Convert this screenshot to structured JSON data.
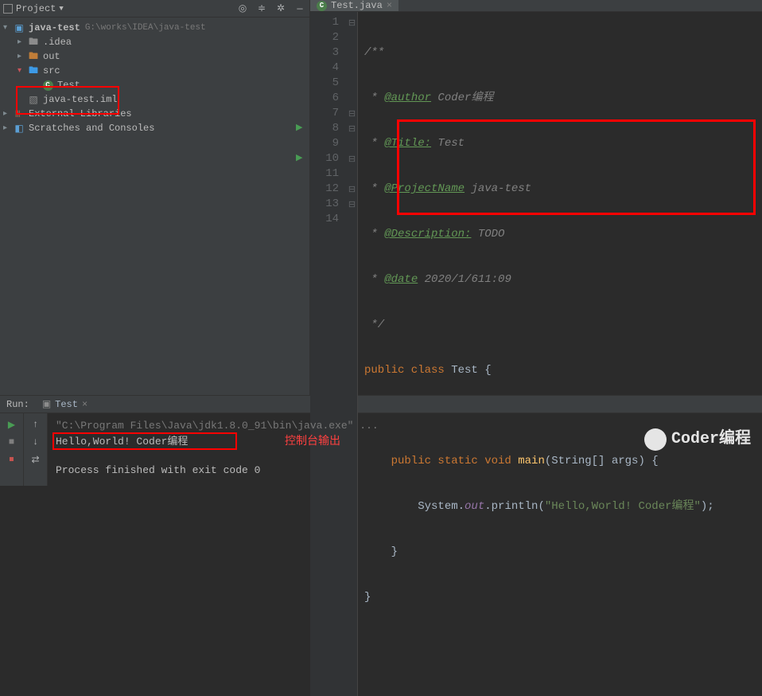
{
  "sidebar": {
    "title": "Project",
    "project": {
      "name": "java-test",
      "path": "G:\\works\\IDEA\\java-test"
    },
    "items": [
      {
        "label": ".idea"
      },
      {
        "label": "out"
      },
      {
        "label": "src"
      },
      {
        "label": "Test"
      },
      {
        "label": "java-test.iml"
      }
    ],
    "external": "External Libraries",
    "scratches": "Scratches and Consoles"
  },
  "editor": {
    "tab_name": "Test.java",
    "lines": {
      "n1": "1",
      "n2": "2",
      "n3": "3",
      "n4": "4",
      "n5": "5",
      "n6": "6",
      "n7": "7",
      "n8": "8",
      "n9": "9",
      "n10": "10",
      "n11": "11",
      "n12": "12",
      "n13": "13",
      "n14": "14"
    },
    "code": {
      "l1": "/**",
      "l2_pre": " * ",
      "l2_tag": "@author",
      "l2_rest": " Coder编程",
      "l3_pre": " * ",
      "l3_tag": "@Title:",
      "l3_rest": " Test",
      "l4_pre": " * ",
      "l4_tag": "@ProjectName",
      "l4_rest": " java-test",
      "l5_pre": " * ",
      "l5_tag": "@Description:",
      "l5_rest": " TODO",
      "l6_pre": " * ",
      "l6_tag": "@date",
      "l6_rest": " 2020/1/611:09",
      "l7": " */",
      "l8_kw1": "public class ",
      "l8_name": "Test ",
      "l8_brace": "{",
      "l10_kw": "    public static void ",
      "l10_name": "main",
      "l10_params": "(String[] args) {",
      "l11_pre": "        System.",
      "l11_out": "out",
      "l11_mid": ".println(",
      "l11_str": "\"Hello,World! Coder编程\"",
      "l11_end": ");",
      "l12": "    }",
      "l13": "}"
    }
  },
  "run": {
    "label": "Run:",
    "tab": "Test",
    "cmd": "\"C:\\Program Files\\Java\\jdk1.8.0_91\\bin\\java.exe\" ...",
    "hello": "Hello,World! Coder编程",
    "exit": "Process finished with exit code 0"
  },
  "annotations": {
    "console_output": "控制台输出"
  },
  "watermark": "Coder编程"
}
